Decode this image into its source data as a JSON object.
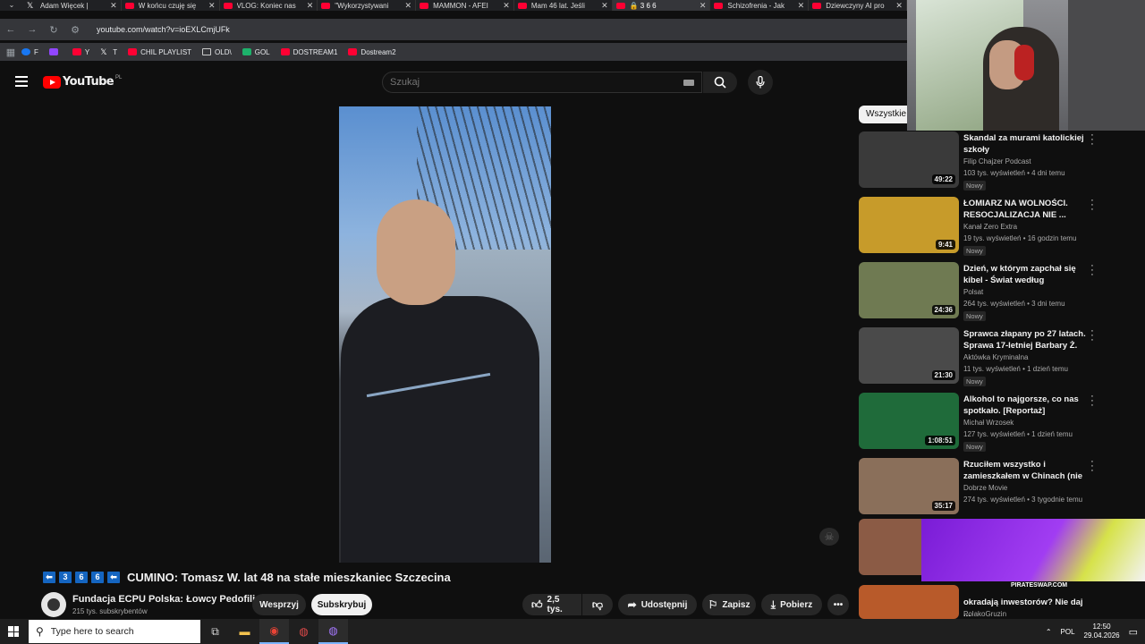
{
  "browser": {
    "tabs": [
      {
        "title": "Adam Więcek |",
        "icon": "x-logo-icon"
      },
      {
        "title": "W końcu czuję się",
        "icon": "youtube-icon"
      },
      {
        "title": "VLOG: Koniec nas",
        "icon": "youtube-icon"
      },
      {
        "title": "\"Wykorzystywani",
        "icon": "youtube-icon"
      },
      {
        "title": "MAMMON - AFEI",
        "icon": "youtube-icon"
      },
      {
        "title": "Mam 46 lat. Jeśli",
        "icon": "youtube-icon"
      },
      {
        "title": "🔒 3 6 6",
        "icon": "youtube-icon",
        "active": true
      },
      {
        "title": "Schizofrenia - Jak",
        "icon": "youtube-icon"
      },
      {
        "title": "Dziewczyny AI pro",
        "icon": "youtube-icon"
      }
    ],
    "url": "youtube.com/watch?v=ioEXLCmjUFk",
    "bookmarks": [
      {
        "label": "F",
        "icon": "facebook-icon"
      },
      {
        "label": "",
        "icon": "twitch-icon"
      },
      {
        "label": "Y",
        "icon": "youtube-icon"
      },
      {
        "label": "T",
        "icon": "x-logo-icon"
      },
      {
        "label": "CHIL PLAYLIST",
        "icon": "youtube-icon"
      },
      {
        "label": "OLD\\",
        "icon": "folder-icon"
      },
      {
        "label": "GOL",
        "icon": "g-icon"
      },
      {
        "label": "DOSTREAM1",
        "icon": "youtube-icon"
      },
      {
        "label": "Dostream2",
        "icon": "youtube-icon"
      }
    ]
  },
  "youtube": {
    "logo_text": "YouTube",
    "region": "PL",
    "search_placeholder": "Szukaj",
    "filter_chip": "Wszystkie"
  },
  "video": {
    "title_squares": [
      "3",
      "6",
      "6"
    ],
    "title": "CUMINO: Tomasz W. lat 48 na stałe mieszkaniec Szczecina",
    "channel": "Fundacja ECPU Polska: Łowcy Pedofili",
    "subscribers": "215 tys. subskrybentów",
    "support_label": "Wesprzyj",
    "subscribe_label": "Subskrybuj",
    "likes": "2,5 tys.",
    "share_label": "Udostępnij",
    "save_label": "Zapisz",
    "download_label": "Pobierz"
  },
  "recommendations": [
    {
      "title": "Skandal za murami katolickiej szkoły",
      "channel": "Filip Chajzer Podcast",
      "meta": "103 tys. wyświetleń • 4 dni temu",
      "duration": "49:22",
      "badge": "Nowy",
      "thumb_color": "#3a3a3a"
    },
    {
      "title": "ŁOMIARZ NA WOLNOŚCI. RESOCJALIZACJA NIE ...",
      "channel": "Kanał Zero Extra",
      "meta": "19 tys. wyświetleń • 16 godzin temu",
      "duration": "9:41",
      "badge": "Nowy",
      "thumb_color": "#c79b2a"
    },
    {
      "title": "Dzień, w którym zapchał się kibel - Świat według Kiepskich...",
      "channel": "Polsat",
      "meta": "264 tys. wyświetleń • 3 dni temu",
      "duration": "24:36",
      "badge": "Nowy",
      "thumb_color": "#6f7a52"
    },
    {
      "title": "Sprawca złapany po 27 latach. Sprawa 17-letniej Barbary Ż.",
      "channel": "Aktówka Kryminalna",
      "meta": "11 tys. wyświetleń • 1 dzień temu",
      "duration": "21:30",
      "badge": "Nowy",
      "thumb_color": "#4a4a4a"
    },
    {
      "title": "Alkohol to najgorsze, co nas spotkało. [Reportaż]",
      "channel": "Michał Wrzosek",
      "meta": "127 tys. wyświetleń • 1 dzień temu",
      "duration": "1:08:51",
      "badge": "Nowy",
      "thumb_color": "#1f6b3a"
    },
    {
      "title": "Rzuciłem wszystko i zamieszkałem w Chinach (nie ...",
      "channel": "Dobrze Movie",
      "meta": "274 tys. wyświetleń • 3 tygodnie temu",
      "duration": "35:17",
      "badge": "",
      "thumb_color": "#8a6f5a"
    }
  ],
  "ad": {
    "site": "PIRATESWAP.COM"
  },
  "partial_rec": {
    "channel": "PolakoGruzin",
    "title_tail": "okradają inwestorów? Nie daj ..."
  },
  "taskbar": {
    "search_placeholder": "Type here to search",
    "lang": "POL",
    "time": "12:50",
    "date": "29.04.2026"
  }
}
